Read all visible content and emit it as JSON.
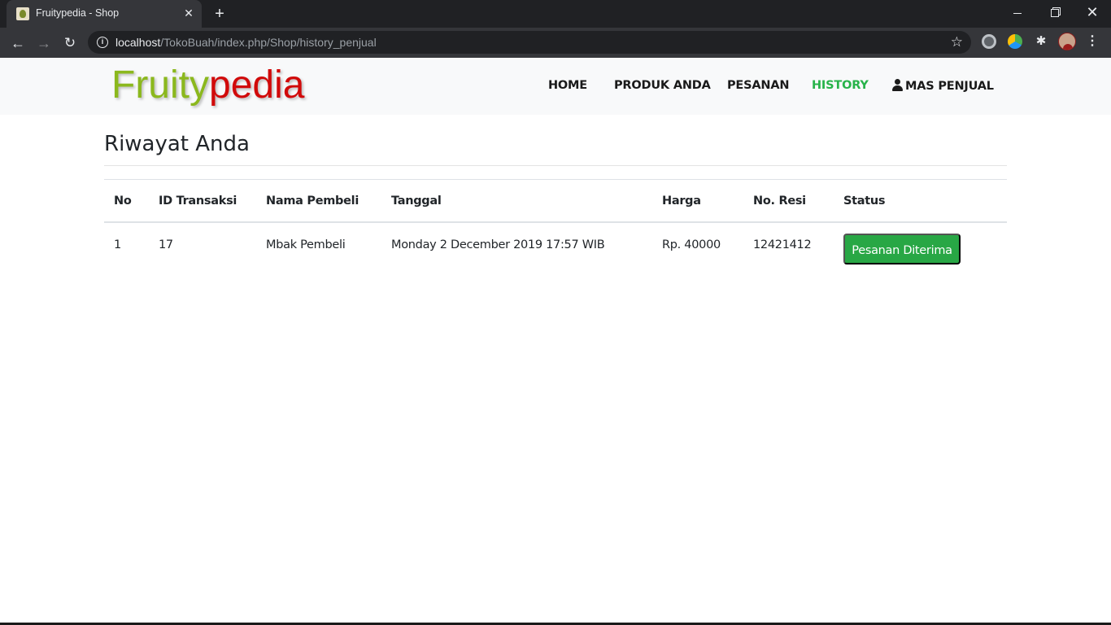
{
  "browser": {
    "tab_title": "Fruitypedia - Shop",
    "url_host": "localhost",
    "url_path": "/TokoBuah/index.php/Shop/history_penjual",
    "icons": {
      "back": "arrow-left-icon",
      "forward": "arrow-right-icon",
      "reload": "reload-icon",
      "info": "info-icon",
      "bookmark": "star-icon",
      "extensions": "puzzle-icon",
      "menu": "more-vert-icon"
    }
  },
  "site": {
    "brand_part1": "Fruity",
    "brand_part2": "pedia",
    "brand_colors": {
      "part1": "#8bb81d",
      "part2": "#d10a0a"
    },
    "nav": {
      "home": "HOME",
      "produk": "PRODUK ANDA",
      "pesanan": "PESANAN",
      "history": "HISTORY",
      "user": "MAS PENJUAL"
    },
    "active_nav_color": "#28b34a"
  },
  "page": {
    "title": "Riwayat Anda",
    "table": {
      "headers": [
        "No",
        "ID Transaksi",
        "Nama Pembeli",
        "Tanggal",
        "Harga",
        "No. Resi",
        "Status"
      ],
      "rows": [
        {
          "no": "1",
          "id_transaksi": "17",
          "nama_pembeli": "Mbak Pembeli",
          "tanggal": "Monday 2 December 2019 17:57 WIB",
          "harga": "Rp. 40000",
          "no_resi": "12421412",
          "status": "Pesanan Diterima"
        }
      ]
    },
    "status_color": "#28a745"
  }
}
